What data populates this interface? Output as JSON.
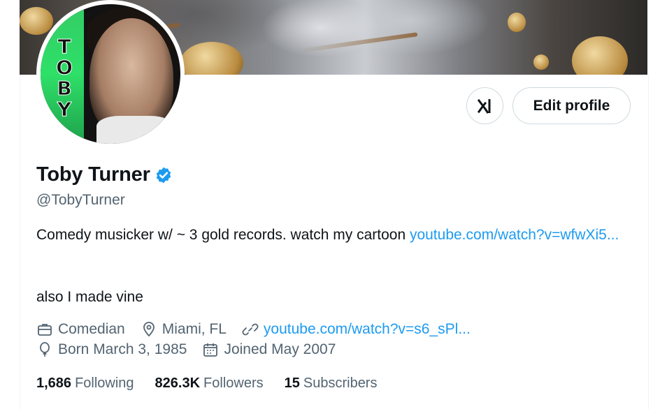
{
  "profile": {
    "name": "Toby Turner",
    "handle": "@TobyTurner",
    "avatar_text": [
      "T",
      "O",
      "B",
      "Y"
    ],
    "bio_text": "Comedy musicker w/ ~ 3 gold records. watch my cartoon ",
    "bio_link": "youtube.com/watch?v=wfwXi5...",
    "bio_line2": "also I made vine",
    "profession": "Comedian",
    "location": "Miami, FL",
    "website": "youtube.com/watch?v=s6_sPl...",
    "birth": "Born March 3, 1985",
    "joined": "Joined May 2007"
  },
  "actions": {
    "grok_icon": "xai-logo-icon",
    "edit_label": "Edit profile"
  },
  "stats": {
    "following_count": "1,686",
    "following_label": "Following",
    "followers_count": "826.3K",
    "followers_label": "Followers",
    "subscribers_count": "15",
    "subscribers_label": "Subscribers"
  },
  "colors": {
    "accent": "#1d9bf0",
    "secondary_text": "#536471",
    "verified": "#1d9bf0"
  }
}
